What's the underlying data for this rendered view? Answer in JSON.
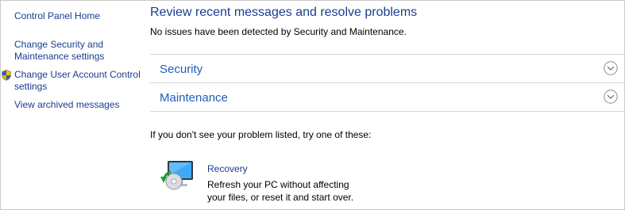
{
  "sidebar": {
    "items": [
      {
        "label": "Control Panel Home"
      },
      {
        "label_line1": "Change Security and",
        "label_line2": "Maintenance settings"
      },
      {
        "label_line1": "Change User Account Control",
        "label_line2": "settings",
        "icon": "uac-shield-icon"
      },
      {
        "label": "View archived messages"
      }
    ]
  },
  "main": {
    "title": "Review recent messages and resolve problems",
    "status": "No issues have been detected by Security and Maintenance.",
    "sections": [
      {
        "label": "Security",
        "icon": "chevron-down-circle-icon"
      },
      {
        "label": "Maintenance",
        "icon": "chevron-down-circle-icon"
      }
    ],
    "try_text": "If you don't see your problem listed, try one of these:",
    "recovery": {
      "label": "Recovery",
      "description_line1": "Refresh your PC without affecting",
      "description_line2": "your files, or reset it and start over.",
      "icon": "recovery-pc-icon"
    }
  },
  "colors": {
    "link": "#1a3d8f",
    "section_title": "#1f5fb8",
    "divider": "#d5d5d5",
    "border": "#c9c9c9"
  }
}
